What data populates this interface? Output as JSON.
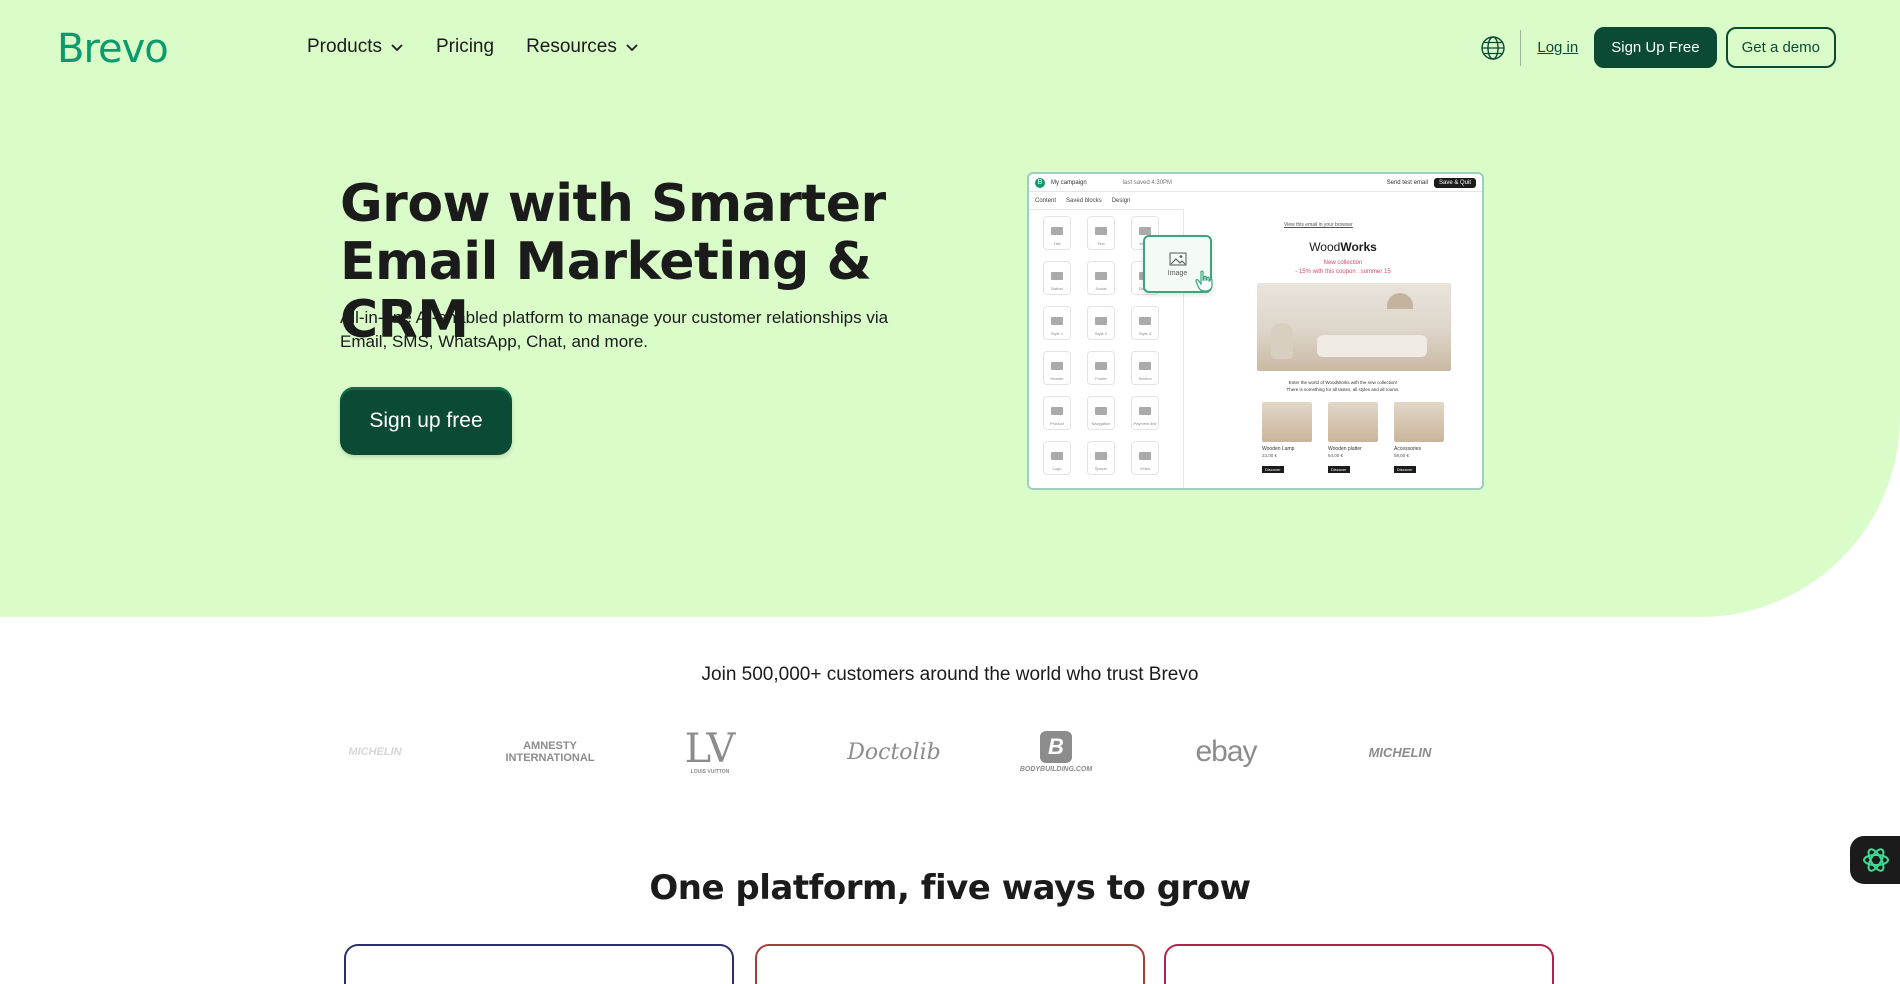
{
  "brand": {
    "logo": "Brevo",
    "accent": "#0b996e",
    "dark_green": "#0b4a35",
    "hero_bg": "#d9fcc9"
  },
  "nav": {
    "items": [
      {
        "label": "Products",
        "has_dropdown": true
      },
      {
        "label": "Pricing",
        "has_dropdown": false
      },
      {
        "label": "Resources",
        "has_dropdown": true
      }
    ],
    "language_icon": "globe-icon",
    "login": "Log in",
    "signup": "Sign Up Free",
    "demo": "Get a demo"
  },
  "hero": {
    "title_line1": "Grow with Smarter",
    "title_line2": "Email Marketing & CRM",
    "subtitle": "All-in-one AI-enabled platform to manage your customer relationships via Email, SMS, WhatsApp, Chat, and more.",
    "cta": "Sign up free"
  },
  "preview": {
    "campaign": "My campaign",
    "saved": "last saved 4:30PM",
    "send_test": "Send test email",
    "save_quit": "Save & Quit",
    "tabs": [
      "Content",
      "Saved blocks",
      "Design"
    ],
    "blocks": [
      "Title",
      "Text",
      "Image",
      "Button",
      "Social",
      "Divider",
      "Style 1",
      "Style 2",
      "Style 3",
      "Header",
      "Footer",
      "Section",
      "Product",
      "Navigation",
      "Payment link",
      "Logo",
      "Spacer",
      "Video"
    ],
    "drag_label": "Image",
    "view_link": "View this email in your browser",
    "email_brand_light": "Wood",
    "email_brand_bold": "Works",
    "promo_line1": "New collection",
    "promo_line2": "- 15% with this coupon : summer 15",
    "copy_line1": "Enter the world of WoodWorks with the new collection!",
    "copy_line2": "There is something for all tastes, all styles and all rooms.",
    "products": [
      {
        "name": "Wooden Lamp",
        "price": "23,00 €",
        "button": "Discover"
      },
      {
        "name": "Wooden platter",
        "price": "64,00 €",
        "button": "Discover"
      },
      {
        "name": "Accessories",
        "price": "59,00 €",
        "button": "Discover"
      }
    ]
  },
  "trust": {
    "text": "Join 500,000+ customers around the world who trust Brevo",
    "logos": [
      "MICHELIN",
      "AMNESTY INTERNATIONAL",
      "LOUIS VUITTON",
      "Doctolib",
      "BODYBUILDING.COM",
      "ebay",
      "MICHELIN"
    ]
  },
  "section": {
    "title": "One platform, five ways to grow",
    "card_colors": [
      "#2d2f6b",
      "#a83b3b",
      "#b5204f"
    ]
  },
  "chat_widget": {
    "icon": "aura-ai-icon"
  }
}
